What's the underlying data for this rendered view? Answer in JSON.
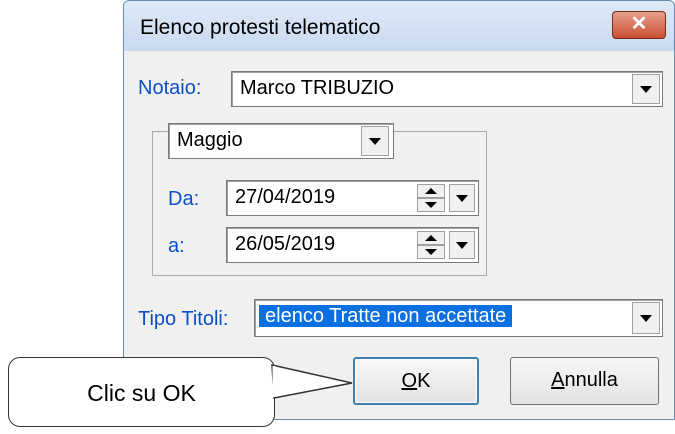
{
  "dialog": {
    "title": "Elenco protesti telematico",
    "close_glyph": "✕",
    "notaio_label": "Notaio:",
    "notaio_value": "Marco TRIBUZIO",
    "month_value": "Maggio",
    "da_label": "Da:",
    "da_value": "27/04/2019",
    "a_label": "a:",
    "a_value": "26/05/2019",
    "tipo_label": "Tipo Titoli:",
    "tipo_value": "elenco Tratte non accettate",
    "ok_accel": "O",
    "ok_rest": "K",
    "cancel_accel": "A",
    "cancel_rest": "nnulla"
  },
  "callout": {
    "text": "Clic su OK"
  },
  "colors": {
    "label_blue": "#0a50c8",
    "selection": "#0a6fe0",
    "close_red": "#c74e35"
  },
  "icons": {
    "close": "close-icon",
    "dropdown": "chevron-down-icon",
    "spin": "spin-updown-icon"
  }
}
